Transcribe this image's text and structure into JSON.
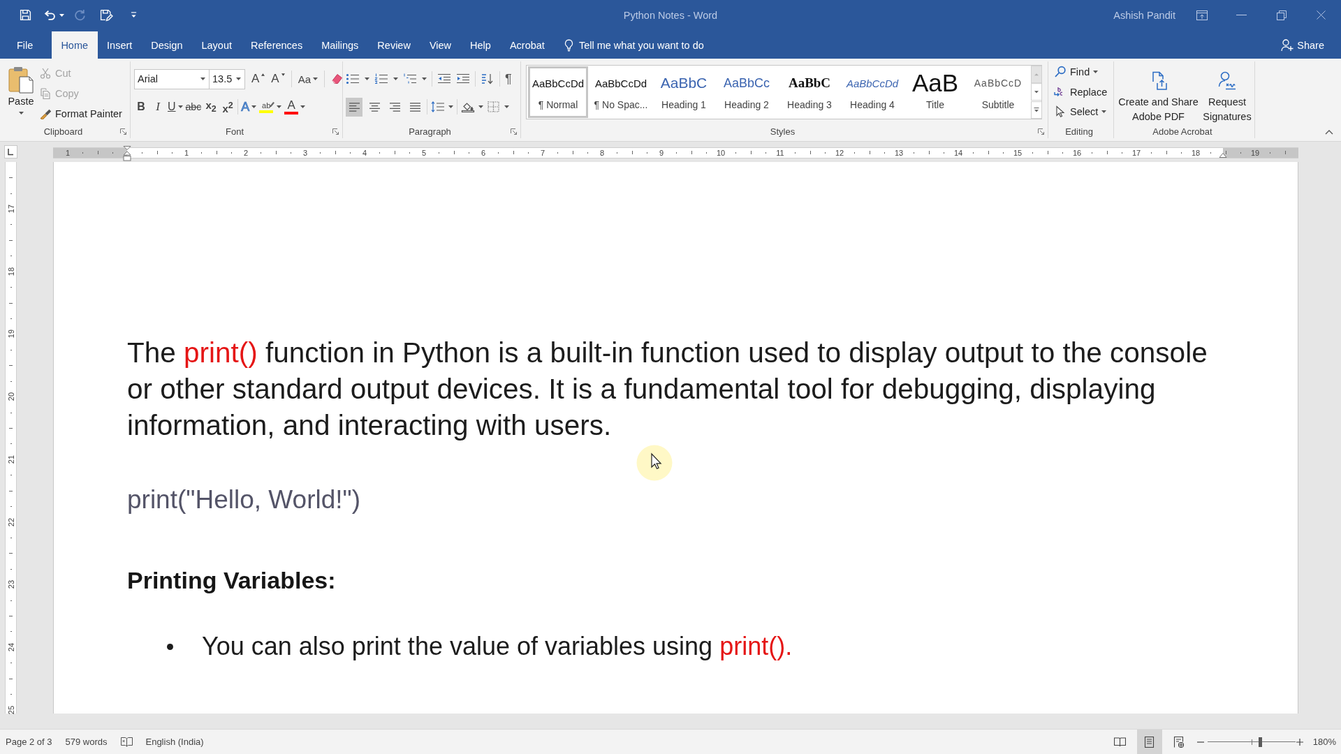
{
  "title_bar": {
    "quick_access": [
      {
        "kind": "save",
        "disabled": false
      },
      {
        "kind": "undo",
        "disabled": false
      },
      {
        "kind": "redo",
        "disabled": true
      },
      {
        "kind": "save_edit",
        "disabled": false
      },
      {
        "kind": "customize",
        "disabled": false
      }
    ],
    "title": "Python Notes - Word",
    "user": "Ashish Pandit"
  },
  "tabs": [
    {
      "label": "File",
      "selected": false
    },
    {
      "label": "Home",
      "selected": true
    },
    {
      "label": "Insert",
      "selected": false
    },
    {
      "label": "Design",
      "selected": false
    },
    {
      "label": "Layout",
      "selected": false
    },
    {
      "label": "References",
      "selected": false
    },
    {
      "label": "Mailings",
      "selected": false
    },
    {
      "label": "Review",
      "selected": false
    },
    {
      "label": "View",
      "selected": false
    },
    {
      "label": "Help",
      "selected": false
    },
    {
      "label": "Acrobat",
      "selected": false
    }
  ],
  "tell_me": "Tell me what you want to do",
  "share": "Share",
  "ribbon": {
    "clipboard": {
      "label": "Clipboard",
      "paste": "Paste",
      "items": [
        {
          "kind": "cut",
          "label": "Cut",
          "disabled": true
        },
        {
          "kind": "copy",
          "label": "Copy",
          "disabled": true
        },
        {
          "kind": "format_painter",
          "label": "Format Painter",
          "disabled": false
        }
      ]
    },
    "font": {
      "label": "Font",
      "font_name": "Arial",
      "font_size": "13.5",
      "row1": [
        {
          "kind": "grow",
          "glyph": "A"
        },
        {
          "kind": "shrink",
          "glyph": "A"
        },
        {
          "kind": "change_case",
          "glyph": "Aa"
        },
        {
          "kind": "clear_formatting"
        }
      ],
      "row2": [
        {
          "kind": "bold",
          "glyph": "B"
        },
        {
          "kind": "italic",
          "glyph": "I"
        },
        {
          "kind": "underline",
          "glyph": "U"
        },
        {
          "kind": "strikethrough",
          "glyph": "abc"
        },
        {
          "kind": "subscript",
          "glyph": "x$_{2}$"
        },
        {
          "kind": "superscript",
          "glyph": "x$^{2}$"
        },
        {
          "kind": "text_effects",
          "glyph": "A"
        },
        {
          "kind": "highlight",
          "glyph": "ab",
          "color": "#ffff00"
        },
        {
          "kind": "font_color",
          "glyph": "A",
          "color": "#ff0000"
        }
      ]
    },
    "paragraph": {
      "label": "Paragraph",
      "row1": [
        {
          "kind": "bullets"
        },
        {
          "kind": "numbering"
        },
        {
          "kind": "multilevel"
        },
        {
          "kind": "decrease_indent"
        },
        {
          "kind": "increase_indent"
        },
        {
          "kind": "sort"
        },
        {
          "kind": "show_marks",
          "glyph": "¶"
        }
      ],
      "align": [
        {
          "kind": "left",
          "selected": true
        },
        {
          "kind": "center",
          "selected": false
        },
        {
          "kind": "right",
          "selected": false
        },
        {
          "kind": "justify",
          "selected": false
        }
      ],
      "row2": [
        {
          "kind": "line_spacing"
        },
        {
          "kind": "shading"
        },
        {
          "kind": "borders"
        }
      ]
    },
    "styles": {
      "label": "Styles",
      "scroll_up": {
        "disabled": true
      },
      "items": [
        {
          "kind": "normal",
          "preview": "AaBbCcDd",
          "label": "¶ Normal",
          "selected": true
        },
        {
          "kind": "no_spacing",
          "preview": "AaBbCcDd",
          "label": "¶ No Spac...",
          "selected": false
        },
        {
          "kind": "heading1",
          "preview": "AaBbC",
          "label": "Heading 1",
          "selected": false
        },
        {
          "kind": "heading2",
          "preview": "AaBbCc",
          "label": "Heading 2",
          "selected": false
        },
        {
          "kind": "heading3",
          "preview": "AaBbC",
          "label": "Heading 3",
          "selected": false
        },
        {
          "kind": "heading4",
          "preview": "AaBbCcDd",
          "label": "Heading 4",
          "selected": false
        },
        {
          "kind": "title",
          "preview": "AaB",
          "label": "Title",
          "selected": false
        },
        {
          "kind": "subtitle",
          "preview": "AaBbCcD",
          "label": "Subtitle",
          "selected": false
        }
      ]
    },
    "editing": {
      "label": "Editing",
      "items": [
        {
          "kind": "find",
          "label": "Find"
        },
        {
          "kind": "replace",
          "label": "Replace"
        },
        {
          "kind": "select",
          "label": "Select"
        }
      ]
    },
    "acrobat": {
      "label": "Adobe Acrobat",
      "items": [
        {
          "kind": "create_pdf",
          "lines": [
            "Create and Share",
            "Adobe PDF"
          ]
        },
        {
          "kind": "request_signatures",
          "lines": [
            "Request",
            "Signatures"
          ]
        }
      ]
    }
  },
  "ruler": {
    "before": [
      "1"
    ],
    "marks": [
      "1",
      "2",
      "3",
      "4",
      "5",
      "6",
      "7",
      "8",
      "9",
      "10",
      "11",
      "12",
      "13",
      "14",
      "15",
      "16",
      "17",
      "18",
      "19"
    ],
    "vertical": [
      "17",
      "18",
      "19",
      "20",
      "21",
      "22",
      "23",
      "24",
      "25"
    ]
  },
  "document": {
    "blocks": [
      {
        "kind": "paragraph",
        "runs": [
          {
            "kind": "text",
            "text": "The "
          },
          {
            "kind": "code",
            "text": "print()"
          },
          {
            "kind": "text",
            "text": " function in Python is a built-in function used to display output to the console or other standard output devices. It is a fundamental tool for debugging, displaying information, and interacting with users."
          }
        ]
      },
      {
        "kind": "code_line",
        "runs": [
          {
            "kind": "text",
            "text": "print(\"Hello, World!\")"
          }
        ]
      },
      {
        "kind": "heading",
        "runs": [
          {
            "kind": "text",
            "text": "Printing Variables:"
          }
        ]
      },
      {
        "kind": "bullet",
        "runs": [
          {
            "kind": "text",
            "text": "You can also print the value of variables using "
          },
          {
            "kind": "code",
            "text": "print()."
          }
        ]
      }
    ]
  },
  "status_bar": {
    "page": "Page 2 of 3",
    "words": "579 words",
    "language": "English (India)",
    "views": [
      {
        "kind": "read",
        "selected": false
      },
      {
        "kind": "print",
        "selected": true
      },
      {
        "kind": "web",
        "selected": false
      }
    ],
    "zoom": {
      "level": 0.6,
      "reading": "180%"
    }
  }
}
